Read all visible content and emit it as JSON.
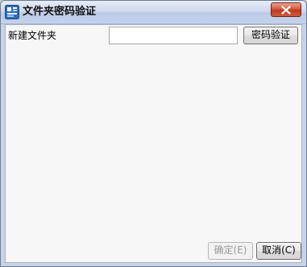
{
  "window": {
    "title": "文件夹密码验证",
    "app_icon": "folder-lock-app-icon",
    "close_icon": "close-icon"
  },
  "form": {
    "folder_label": "新建文件夹",
    "password_value": "",
    "verify_label": "密码验证"
  },
  "footer": {
    "ok_label": "确定(E)",
    "cancel_label": "取消(C)"
  },
  "colors": {
    "close_button": "#c0391b",
    "titlebar": "#c6d2ea",
    "client_bg": "#f7f7f7",
    "disabled_text": "#9a9a9a"
  }
}
